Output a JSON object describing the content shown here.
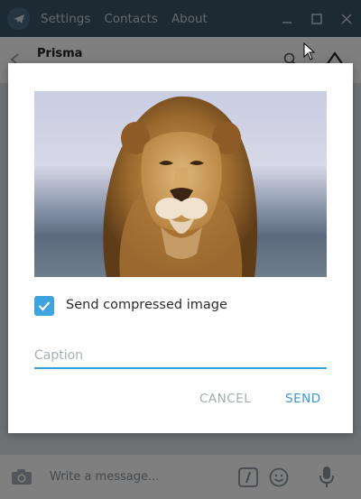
{
  "window": {
    "menu": [
      "Settings",
      "Contacts",
      "About"
    ]
  },
  "chat": {
    "title": "Prisma",
    "compose_placeholder": "Write a message..."
  },
  "dialog": {
    "checkbox_label": "Send compressed image",
    "checkbox_checked": true,
    "caption_placeholder": "Caption",
    "caption_value": "",
    "cancel_label": "CANCEL",
    "send_label": "SEND",
    "image_subject": "lion"
  },
  "colors": {
    "titlebar": "#3a5366",
    "accent": "#3ba0df",
    "checkbox": "#3fa3e0",
    "send_text": "#3a97d6"
  }
}
